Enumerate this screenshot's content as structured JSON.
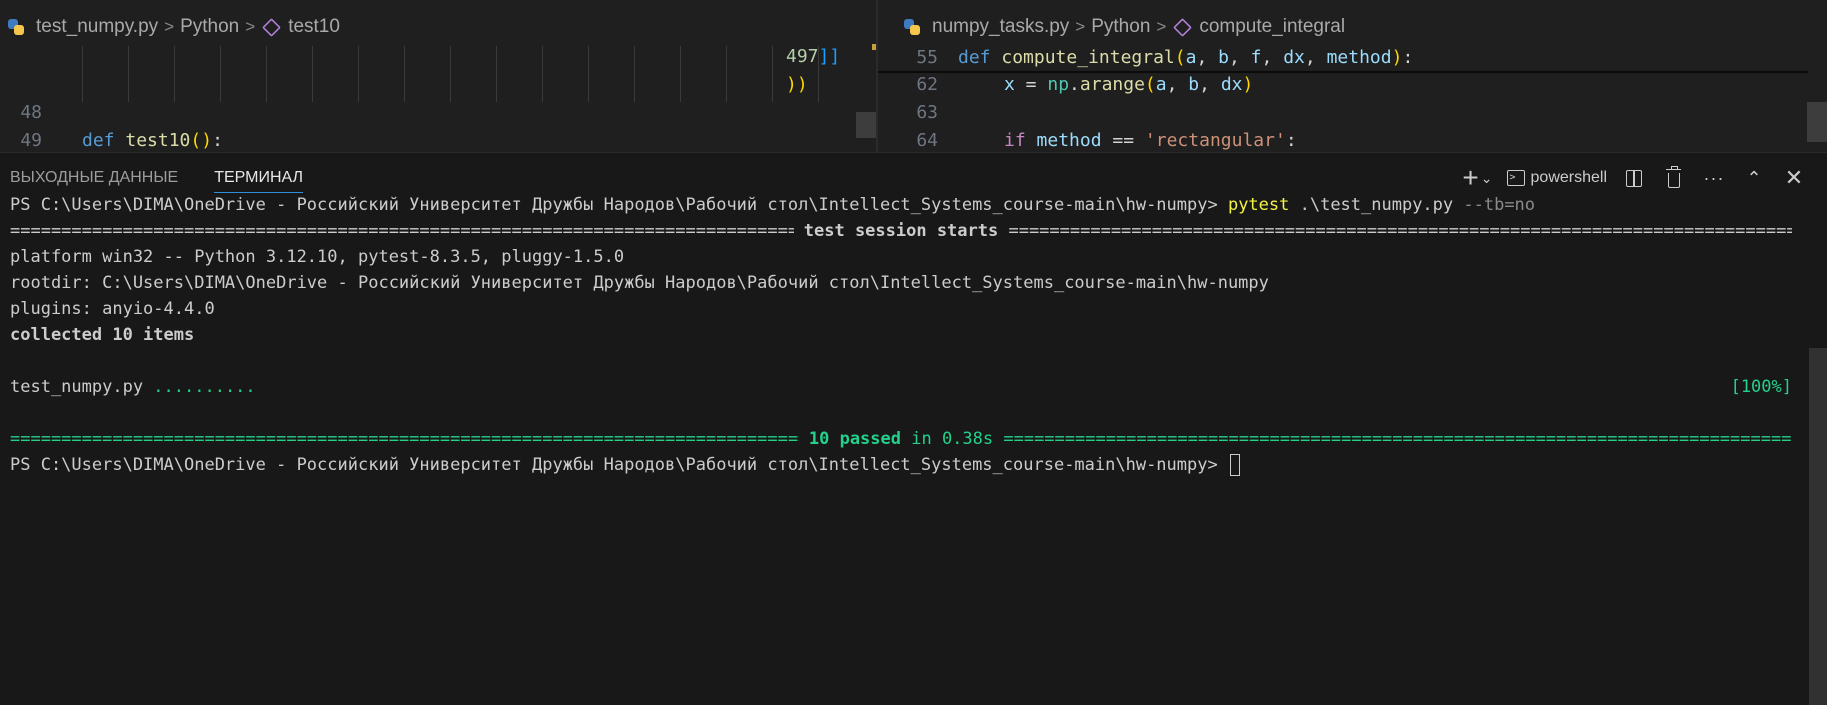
{
  "editor_left": {
    "breadcrumb": {
      "file": "test_numpy.py",
      "lang": "Python",
      "symbol": "test10"
    },
    "code_tail": {
      "number": "497",
      "brackets": "]]",
      "close": "))"
    },
    "lines": [
      {
        "num": "48"
      },
      {
        "num": "49",
        "keyword": "def",
        "name": "test10",
        "paren": "()",
        "colon": ":"
      }
    ]
  },
  "editor_right": {
    "breadcrumb": {
      "file": "numpy_tasks.py",
      "lang": "Python",
      "symbol": "compute_integral"
    },
    "sticky": {
      "num": "55",
      "keyword": "def",
      "name": "compute_integral",
      "open": "(",
      "params": [
        "a",
        "b",
        "f",
        "dx",
        "method"
      ],
      "close": ")",
      "colon": ":"
    },
    "line62": {
      "num": "62",
      "var": "x",
      "op": " = ",
      "module": "np",
      "func": "arange",
      "open": "(",
      "args": [
        "a",
        "b",
        "dx"
      ],
      "close": ")"
    },
    "line63": {
      "num": "63"
    },
    "line64": {
      "num": "64",
      "keyword": "if",
      "var": "method",
      "op": " == ",
      "str": "'rectangular'",
      "colon": ":"
    }
  },
  "panel": {
    "tabs": [
      {
        "label": "ВЫХОДНЫЕ ДАННЫЕ",
        "active": false
      },
      {
        "label": "ТЕРМИНАЛ",
        "active": true
      }
    ],
    "shell": "powershell",
    "icons": [
      "plus-icon",
      "chevron-down-icon",
      "terminal-icon",
      "split-icon",
      "trash-icon",
      "more-icon",
      "maximize-icon",
      "close-icon"
    ]
  },
  "terminal": {
    "prompt": "PS C:\\Users\\DIMA\\OneDrive - Российский Университет Дружбы Народов\\Рабочий стол\\Intellect_Systems_course-main\\hw-numpy> ",
    "cmd_name": "pytest",
    "cmd_arg": " .\\test_numpy.py",
    "cmd_flag": " --tb=no",
    "session_title": " test session starts ",
    "platform": "platform win32 -- Python 3.12.10, pytest-8.3.5, pluggy-1.5.0",
    "rootdir": "rootdir: C:\\Users\\DIMA\\OneDrive - Российский Университет Дружбы Народов\\Рабочий стол\\Intellect_Systems_course-main\\hw-numpy",
    "plugins": "plugins: anyio-4.4.0",
    "collected": "collected 10 items",
    "result_file": "test_numpy.py ",
    "result_dots": "..........",
    "result_pct": "[100%]",
    "summary_passed": " 10 passed",
    "summary_time": " in 0.38s ",
    "final_prompt": "PS C:\\Users\\DIMA\\OneDrive - Российский Университет Дружбы Народов\\Рабочий стол\\Intellect_Systems_course-main\\hw-numpy> "
  },
  "colors": {
    "accent": "#2f8fd9",
    "pass_green": "#23d18b",
    "cmd_yellow": "#f5f543"
  }
}
